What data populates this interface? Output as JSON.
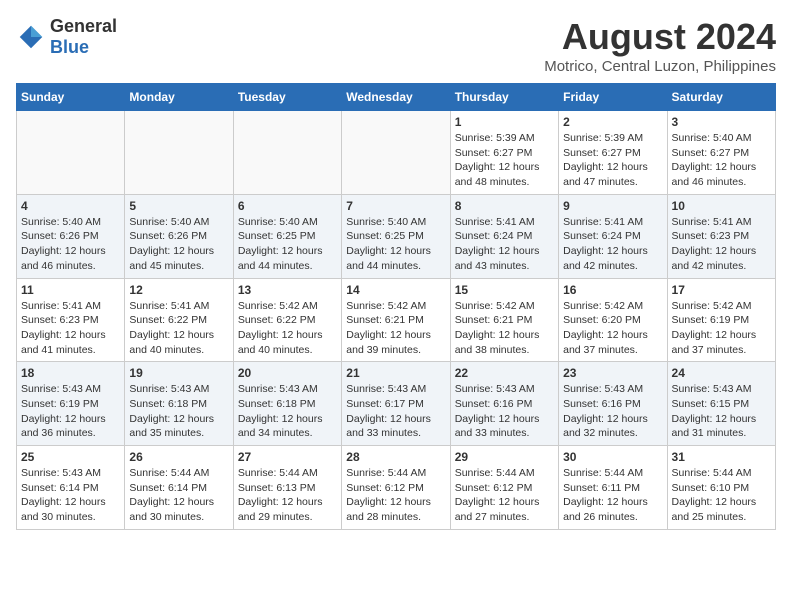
{
  "logo": {
    "text_general": "General",
    "text_blue": "Blue"
  },
  "title": "August 2024",
  "subtitle": "Motrico, Central Luzon, Philippines",
  "days_of_week": [
    "Sunday",
    "Monday",
    "Tuesday",
    "Wednesday",
    "Thursday",
    "Friday",
    "Saturday"
  ],
  "weeks": [
    [
      {
        "day": "",
        "info": ""
      },
      {
        "day": "",
        "info": ""
      },
      {
        "day": "",
        "info": ""
      },
      {
        "day": "",
        "info": ""
      },
      {
        "day": "1",
        "info": "Sunrise: 5:39 AM\nSunset: 6:27 PM\nDaylight: 12 hours\nand 48 minutes."
      },
      {
        "day": "2",
        "info": "Sunrise: 5:39 AM\nSunset: 6:27 PM\nDaylight: 12 hours\nand 47 minutes."
      },
      {
        "day": "3",
        "info": "Sunrise: 5:40 AM\nSunset: 6:27 PM\nDaylight: 12 hours\nand 46 minutes."
      }
    ],
    [
      {
        "day": "4",
        "info": "Sunrise: 5:40 AM\nSunset: 6:26 PM\nDaylight: 12 hours\nand 46 minutes."
      },
      {
        "day": "5",
        "info": "Sunrise: 5:40 AM\nSunset: 6:26 PM\nDaylight: 12 hours\nand 45 minutes."
      },
      {
        "day": "6",
        "info": "Sunrise: 5:40 AM\nSunset: 6:25 PM\nDaylight: 12 hours\nand 44 minutes."
      },
      {
        "day": "7",
        "info": "Sunrise: 5:40 AM\nSunset: 6:25 PM\nDaylight: 12 hours\nand 44 minutes."
      },
      {
        "day": "8",
        "info": "Sunrise: 5:41 AM\nSunset: 6:24 PM\nDaylight: 12 hours\nand 43 minutes."
      },
      {
        "day": "9",
        "info": "Sunrise: 5:41 AM\nSunset: 6:24 PM\nDaylight: 12 hours\nand 42 minutes."
      },
      {
        "day": "10",
        "info": "Sunrise: 5:41 AM\nSunset: 6:23 PM\nDaylight: 12 hours\nand 42 minutes."
      }
    ],
    [
      {
        "day": "11",
        "info": "Sunrise: 5:41 AM\nSunset: 6:23 PM\nDaylight: 12 hours\nand 41 minutes."
      },
      {
        "day": "12",
        "info": "Sunrise: 5:41 AM\nSunset: 6:22 PM\nDaylight: 12 hours\nand 40 minutes."
      },
      {
        "day": "13",
        "info": "Sunrise: 5:42 AM\nSunset: 6:22 PM\nDaylight: 12 hours\nand 40 minutes."
      },
      {
        "day": "14",
        "info": "Sunrise: 5:42 AM\nSunset: 6:21 PM\nDaylight: 12 hours\nand 39 minutes."
      },
      {
        "day": "15",
        "info": "Sunrise: 5:42 AM\nSunset: 6:21 PM\nDaylight: 12 hours\nand 38 minutes."
      },
      {
        "day": "16",
        "info": "Sunrise: 5:42 AM\nSunset: 6:20 PM\nDaylight: 12 hours\nand 37 minutes."
      },
      {
        "day": "17",
        "info": "Sunrise: 5:42 AM\nSunset: 6:19 PM\nDaylight: 12 hours\nand 37 minutes."
      }
    ],
    [
      {
        "day": "18",
        "info": "Sunrise: 5:43 AM\nSunset: 6:19 PM\nDaylight: 12 hours\nand 36 minutes."
      },
      {
        "day": "19",
        "info": "Sunrise: 5:43 AM\nSunset: 6:18 PM\nDaylight: 12 hours\nand 35 minutes."
      },
      {
        "day": "20",
        "info": "Sunrise: 5:43 AM\nSunset: 6:18 PM\nDaylight: 12 hours\nand 34 minutes."
      },
      {
        "day": "21",
        "info": "Sunrise: 5:43 AM\nSunset: 6:17 PM\nDaylight: 12 hours\nand 33 minutes."
      },
      {
        "day": "22",
        "info": "Sunrise: 5:43 AM\nSunset: 6:16 PM\nDaylight: 12 hours\nand 33 minutes."
      },
      {
        "day": "23",
        "info": "Sunrise: 5:43 AM\nSunset: 6:16 PM\nDaylight: 12 hours\nand 32 minutes."
      },
      {
        "day": "24",
        "info": "Sunrise: 5:43 AM\nSunset: 6:15 PM\nDaylight: 12 hours\nand 31 minutes."
      }
    ],
    [
      {
        "day": "25",
        "info": "Sunrise: 5:43 AM\nSunset: 6:14 PM\nDaylight: 12 hours\nand 30 minutes."
      },
      {
        "day": "26",
        "info": "Sunrise: 5:44 AM\nSunset: 6:14 PM\nDaylight: 12 hours\nand 30 minutes."
      },
      {
        "day": "27",
        "info": "Sunrise: 5:44 AM\nSunset: 6:13 PM\nDaylight: 12 hours\nand 29 minutes."
      },
      {
        "day": "28",
        "info": "Sunrise: 5:44 AM\nSunset: 6:12 PM\nDaylight: 12 hours\nand 28 minutes."
      },
      {
        "day": "29",
        "info": "Sunrise: 5:44 AM\nSunset: 6:12 PM\nDaylight: 12 hours\nand 27 minutes."
      },
      {
        "day": "30",
        "info": "Sunrise: 5:44 AM\nSunset: 6:11 PM\nDaylight: 12 hours\nand 26 minutes."
      },
      {
        "day": "31",
        "info": "Sunrise: 5:44 AM\nSunset: 6:10 PM\nDaylight: 12 hours\nand 25 minutes."
      }
    ]
  ]
}
